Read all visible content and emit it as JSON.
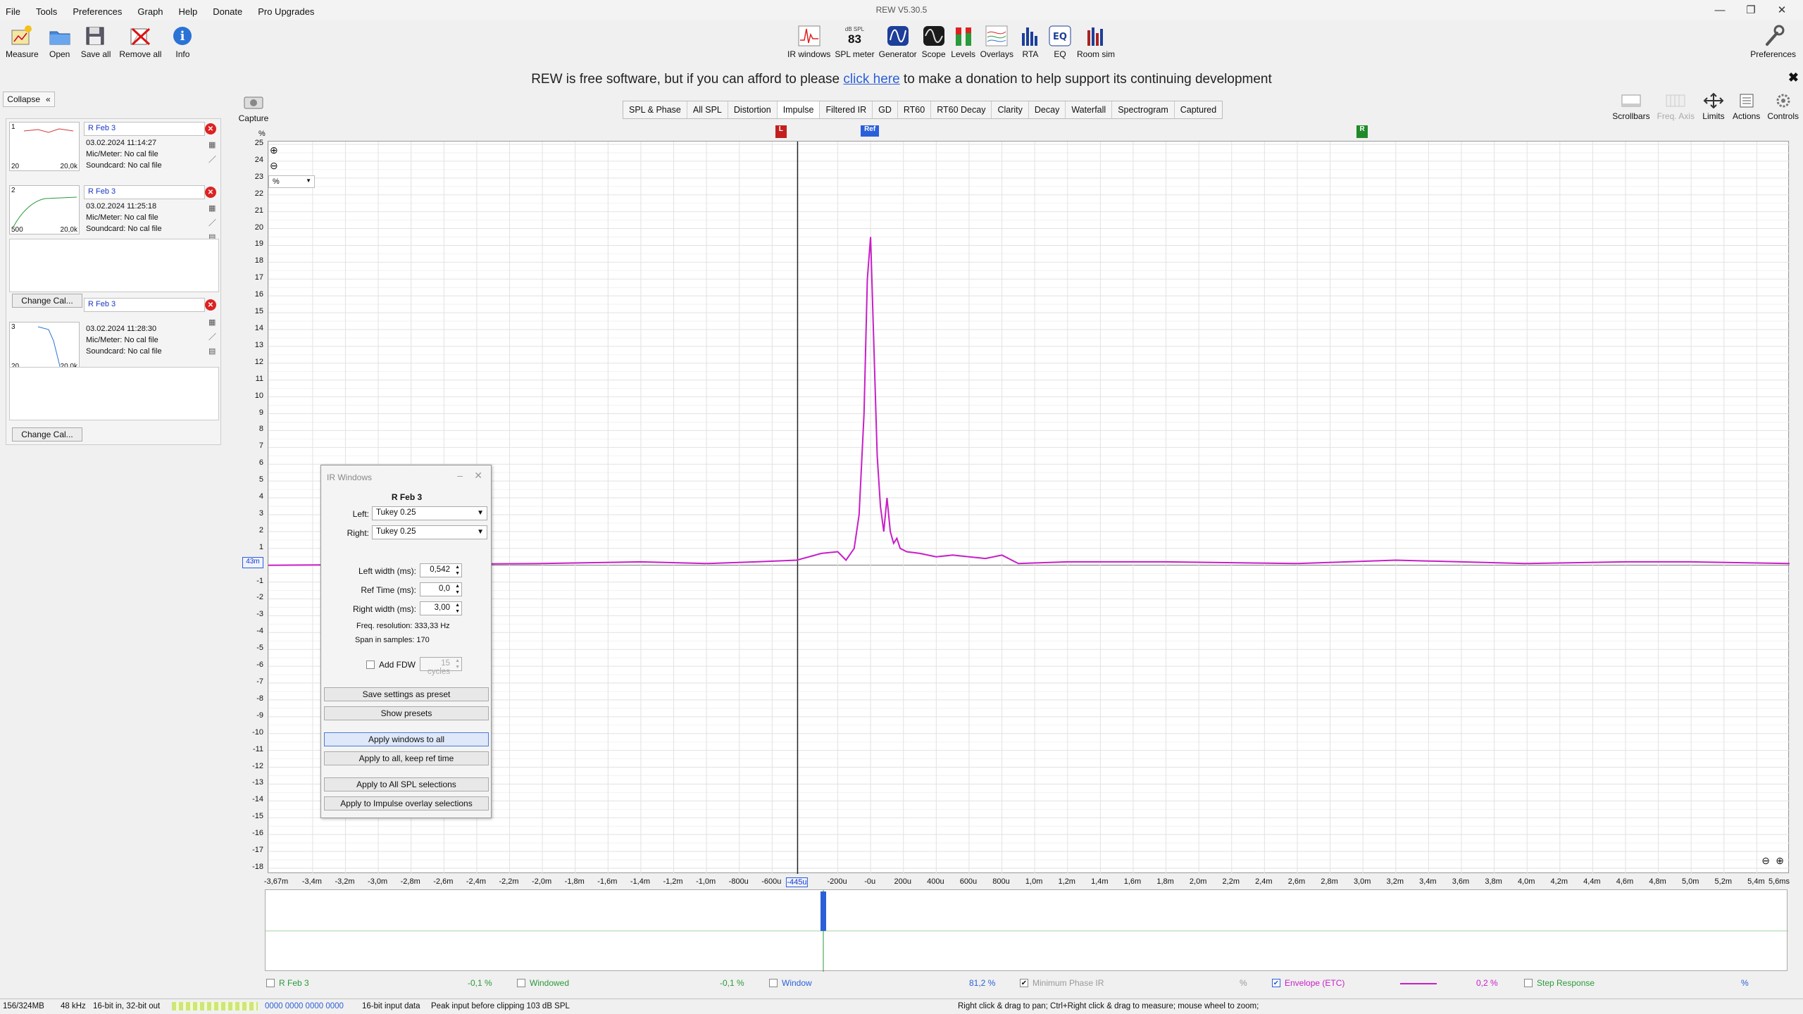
{
  "app": {
    "title": "REW V5.30.5",
    "menu": [
      "File",
      "Tools",
      "Preferences",
      "Graph",
      "Help",
      "Donate",
      "Pro Upgrades"
    ],
    "window_controls": [
      "—",
      "❐",
      "✕"
    ]
  },
  "toolbar_left": [
    {
      "label": "Measure",
      "icon": "measure-icon"
    },
    {
      "label": "Open",
      "icon": "folder-icon"
    },
    {
      "label": "Save all",
      "icon": "save-icon"
    },
    {
      "label": "Remove all",
      "icon": "remove-all-icon"
    },
    {
      "label": "Info",
      "icon": "info-icon"
    }
  ],
  "toolbar_mid": [
    {
      "label": "IR windows",
      "icon": "ir-windows-icon"
    },
    {
      "label": "SPL meter",
      "icon": "spl-meter-icon",
      "badge_top": "dB SPL",
      "badge_value": "83"
    },
    {
      "label": "Generator",
      "icon": "generator-icon"
    },
    {
      "label": "Scope",
      "icon": "scope-icon"
    },
    {
      "label": "Levels",
      "icon": "levels-icon"
    },
    {
      "label": "Overlays",
      "icon": "overlays-icon"
    },
    {
      "label": "RTA",
      "icon": "rta-icon"
    },
    {
      "label": "EQ",
      "icon": "eq-icon"
    },
    {
      "label": "Room sim",
      "icon": "room-sim-icon"
    }
  ],
  "toolbar_right": {
    "label": "Preferences",
    "icon": "wrench-icon"
  },
  "donation": {
    "before": "REW is free software, but if you can afford to please ",
    "link": "click here",
    "after": " to make a donation to help support its continuing development",
    "close": "✖"
  },
  "left_panel": {
    "collapse": "Collapse",
    "change_cal": "Change Cal...",
    "measurements": [
      {
        "index": "1",
        "name": "R Feb 3",
        "date": "03.02.2024 11:14:27",
        "mic": "Mic/Meter: No cal file",
        "soundcard": "Soundcard: No cal file",
        "f_lo": "20",
        "f_hi": "20,0k",
        "color": "#d23a3a"
      },
      {
        "index": "2",
        "name": "R Feb 3",
        "date": "03.02.2024 11:25:18",
        "mic": "Mic/Meter: No cal file",
        "soundcard": "Soundcard: No cal file",
        "f_lo": "500",
        "f_hi": "20,0k",
        "color": "#2a9a3a"
      },
      {
        "index": "3",
        "name": "R Feb 3",
        "date": "03.02.2024 11:28:30",
        "mic": "Mic/Meter: No cal file",
        "soundcard": "Soundcard: No cal file",
        "f_lo": "20",
        "f_hi": "20,0k",
        "color": "#2a73d0"
      }
    ]
  },
  "graph": {
    "capture_label": "Capture",
    "tabs": [
      "SPL & Phase",
      "All SPL",
      "Distortion",
      "Impulse",
      "Filtered IR",
      "GD",
      "RT60",
      "RT60 Decay",
      "Clarity",
      "Decay",
      "Waterfall",
      "Spectrogram",
      "Captured"
    ],
    "active_tab": "Impulse",
    "controls": [
      {
        "label": "Scrollbars",
        "dim": false
      },
      {
        "label": "Freq. Axis",
        "dim": true
      },
      {
        "label": "Limits",
        "dim": false
      },
      {
        "label": "Actions",
        "dim": false
      },
      {
        "label": "Controls",
        "dim": false
      }
    ],
    "unit_select": "%",
    "y_unit": "%",
    "cursor_value": "43m",
    "markers": {
      "left": "L",
      "ref": "Ref",
      "right": "R"
    }
  },
  "chart_data": {
    "type": "line",
    "title": "",
    "xlabel": "",
    "ylabel": "%",
    "xlim": [
      -3.67,
      5.6
    ],
    "ylim": [
      -18,
      25
    ],
    "grid": true,
    "y_ticks": [
      "25",
      "24",
      "23",
      "22",
      "21",
      "20",
      "19",
      "18",
      "17",
      "16",
      "15",
      "14",
      "13",
      "12",
      "11",
      "10",
      "9",
      "8",
      "7",
      "6",
      "5",
      "4",
      "3",
      "2",
      "1",
      "0",
      "-1",
      "-2",
      "-3",
      "-4",
      "-5",
      "-6",
      "-7",
      "-8",
      "-9",
      "-10",
      "-11",
      "-12",
      "-13",
      "-14",
      "-15",
      "-16",
      "-17",
      "-18"
    ],
    "x_ticks": [
      "-3,67m",
      "-3,4m",
      "-3,2m",
      "-3,0m",
      "-2,8m",
      "-2,6m",
      "-2,4m",
      "-2,2m",
      "-2,0m",
      "-1,8m",
      "-1,6m",
      "-1,4m",
      "-1,2m",
      "-1,0m",
      "-800u",
      "-600u",
      "-445u",
      "-200u",
      "-0u",
      "200u",
      "400u",
      "600u",
      "800u",
      "1,0m",
      "1,2m",
      "1,4m",
      "1,6m",
      "1,8m",
      "2,0m",
      "2,2m",
      "2,4m",
      "2,6m",
      "2,8m",
      "3,0m",
      "3,2m",
      "3,4m",
      "3,6m",
      "3,8m",
      "4,0m",
      "4,2m",
      "4,4m",
      "4,6m",
      "4,8m",
      "5,0m",
      "5,2m",
      "5,4m",
      "5,6ms"
    ],
    "series": [
      {
        "name": "Envelope (ETC)",
        "color": "#c81ec8",
        "x": [
          -3.67,
          -2.0,
          -1.4,
          -1.0,
          -0.7,
          -0.45,
          -0.3,
          -0.2,
          -0.15,
          -0.1,
          -0.07,
          -0.04,
          -0.02,
          0.0,
          0.02,
          0.04,
          0.06,
          0.08,
          0.1,
          0.12,
          0.14,
          0.16,
          0.18,
          0.22,
          0.3,
          0.4,
          0.5,
          0.6,
          0.7,
          0.8,
          0.9,
          1.2,
          1.8,
          2.6,
          3.2,
          4.0,
          4.6,
          5.0,
          5.6
        ],
        "y": [
          0.0,
          0.1,
          0.2,
          0.1,
          0.2,
          0.3,
          0.7,
          0.8,
          0.3,
          1.0,
          3.0,
          9.0,
          17.0,
          19.5,
          13.0,
          6.5,
          3.5,
          2.0,
          4.0,
          2.0,
          1.3,
          1.6,
          1.0,
          0.8,
          0.7,
          0.5,
          0.6,
          0.5,
          0.4,
          0.6,
          0.1,
          0.2,
          0.2,
          0.1,
          0.3,
          0.1,
          0.2,
          0.2,
          0.1
        ]
      }
    ]
  },
  "ir_windows": {
    "title": "IR Windows",
    "measurement": "R Feb 3",
    "left_label": "Left:",
    "left_value": "Tukey 0.25",
    "right_label": "Right:",
    "right_value": "Tukey 0.25",
    "left_width_label": "Left width (ms):",
    "left_width": "0,542",
    "ref_time_label": "Ref Time (ms):",
    "ref_time": "0,0",
    "right_width_label": "Right width (ms):",
    "right_width": "3,00",
    "freq_res": "Freq. resolution: 333,33 Hz",
    "span": "Span in samples: 170",
    "add_fdw": "Add FDW",
    "fdw_cycles": "15 cycles",
    "buttons": [
      "Save settings as preset",
      "Show presets",
      "Apply windows to all",
      "Apply to all, keep ref time",
      "Apply to All SPL selections",
      "Apply to Impulse overlay selections"
    ]
  },
  "legend": [
    {
      "label": "R Feb 3",
      "value": "-0,1 %",
      "checked": false
    },
    {
      "label": "Windowed",
      "value": "-0,1 %",
      "checked": false
    },
    {
      "label": "Window",
      "value": "81,2 %",
      "checked": false
    },
    {
      "label": "Minimum Phase IR",
      "value": "%",
      "checked": true
    },
    {
      "label": "Envelope (ETC)",
      "value": "0,2 %",
      "checked": true
    },
    {
      "label": "Step Response",
      "value": "%",
      "checked": false
    }
  ],
  "status": {
    "memory": "156/324MB",
    "rate": "48 kHz",
    "bits": "16-bit in, 32-bit out",
    "levels": "0000 0000  0000 0000",
    "input": "16-bit input data",
    "peak": "Peak input before clipping 103 dB SPL",
    "hint": "Right click & drag to pan; Ctrl+Right click & drag to measure; mouse wheel to zoom;"
  }
}
